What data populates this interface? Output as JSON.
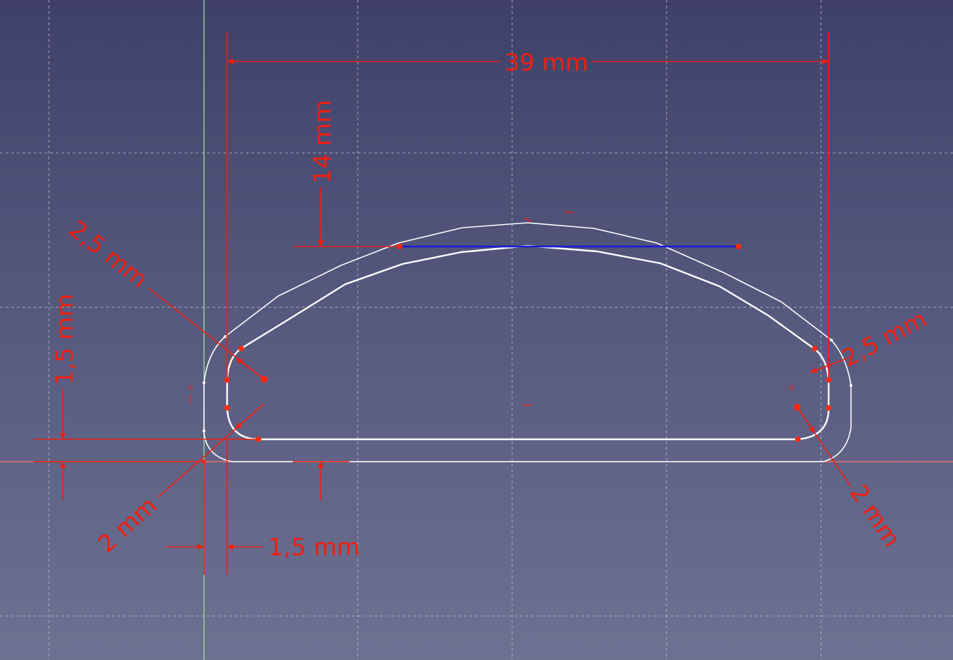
{
  "colors": {
    "dimension": "#ee1f10",
    "geometry": "#ffffff",
    "selected_line": "#1a1ad6",
    "vertex": "#ff2a10",
    "y_axis": "#8fe08a",
    "x_axis": "#e87070",
    "grid": "#c6c8d8",
    "background_top": "#3f4069",
    "background_bottom": "#6d7192"
  },
  "dimensions": {
    "width": "39 mm",
    "height": "14 mm",
    "inner_fillet_left": "2,5 mm",
    "inner_fillet_right": "2,5 mm",
    "outer_fillet_left": "2 mm",
    "outer_fillet_right": "2 mm",
    "vertical_offset": "1,5 mm",
    "horizontal_offset": "1,5 mm"
  }
}
